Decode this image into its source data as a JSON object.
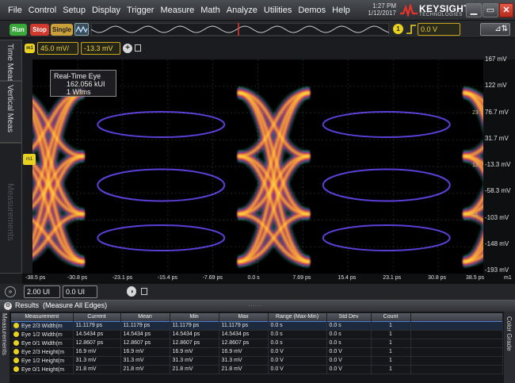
{
  "menu": {
    "items": [
      "File",
      "Control",
      "Setup",
      "Display",
      "Trigger",
      "Measure",
      "Math",
      "Analyze",
      "Utilities",
      "Demos",
      "Help"
    ],
    "time": "1:27 PM",
    "date": "1/12/2017",
    "brand": "KEYSIGHT",
    "brand_sub": "TECHNOLOGIES"
  },
  "control": {
    "run": "Run",
    "stop": "Stop",
    "single": "Single",
    "trigger_channel": "1",
    "trigger_level": "0.0 V",
    "autoscale_icon": "autoscale-icon"
  },
  "side_tabs": {
    "time_meas": "Time Meas",
    "vertical_meas": "Vertical Meas",
    "measurements": "Measurements"
  },
  "channel": {
    "label": "m1",
    "scale": "45.0 mV/",
    "offset": "-13.3 mV"
  },
  "waveform": {
    "y_labels": [
      "167 mV",
      "122 mV",
      "76.7 mV",
      "31.7 mV",
      "-13.3 mV",
      "-58.3 mV",
      "-103 mV",
      "-148 mV",
      "-193 mV"
    ],
    "x_labels": [
      "-38.5 ps",
      "-30.8 ps",
      "-23.1 ps",
      "-15.4 ps",
      "-7.69 ps",
      "0.0 s",
      "7.69 ps",
      "15.4 ps",
      "23.1 ps",
      "30.8 ps",
      "38.5 ps"
    ],
    "x_unit_marker": "m1",
    "ref_markers": [
      "23",
      "12",
      "01"
    ],
    "offset_marker": "m1",
    "info_title": "Real-Time Eye",
    "info_ui": "162.056 kUI",
    "info_wfms": "1 Wfms",
    "colors": {
      "hot": "#ffe94a",
      "warm": "#f26a1f",
      "mid": "#c4226b",
      "cool": "#5c3fd6",
      "edge": "#29c86a"
    }
  },
  "timebase": {
    "scale": "2.00 UI",
    "position": "0.0 UI"
  },
  "results": {
    "title": "Results",
    "subtitle": "(Measure All Edges)",
    "grip": "......",
    "left_tab": "Measurements",
    "right_tab": "Color Grade",
    "columns": [
      "Measurement",
      "Current",
      "Mean",
      "Min",
      "Max",
      "Range (Max-Min)",
      "Std Dev",
      "Count",
      ""
    ],
    "rows": [
      {
        "name": "Eye 2/3 Width(m",
        "current": "11.1179 ps",
        "mean": "11.1179 ps",
        "min": "11.1179 ps",
        "max": "11.1179 ps",
        "range": "0.0 s",
        "std": "0.0 s",
        "count": "1"
      },
      {
        "name": "Eye 1/2 Width(m",
        "current": "14.5434 ps",
        "mean": "14.5434 ps",
        "min": "14.5434 ps",
        "max": "14.5434 ps",
        "range": "0.0 s",
        "std": "0.0 s",
        "count": "1"
      },
      {
        "name": "Eye 0/1 Width(m",
        "current": "12.8607 ps",
        "mean": "12.8607 ps",
        "min": "12.8607 ps",
        "max": "12.8607 ps",
        "range": "0.0 s",
        "std": "0.0 s",
        "count": "1"
      },
      {
        "name": "Eye 2/3 Height(m",
        "current": "16.9 mV",
        "mean": "16.9 mV",
        "min": "16.9 mV",
        "max": "16.9 mV",
        "range": "0.0 V",
        "std": "0.0 V",
        "count": "1"
      },
      {
        "name": "Eye 1/2 Height(m",
        "current": "31.3 mV",
        "mean": "31.3 mV",
        "min": "31.3 mV",
        "max": "31.3 mV",
        "range": "0.0 V",
        "std": "0.0 V",
        "count": "1"
      },
      {
        "name": "Eye 0/1 Height(m",
        "current": "21.8 mV",
        "mean": "21.8 mV",
        "min": "21.8 mV",
        "max": "21.8 mV",
        "range": "0.0 V",
        "std": "0.0 V",
        "count": "1"
      }
    ]
  }
}
